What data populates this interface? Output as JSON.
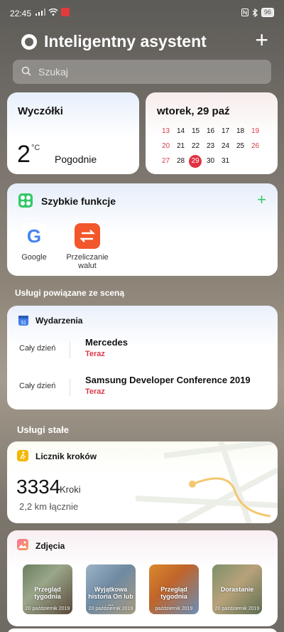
{
  "status": {
    "time": "22:45",
    "battery": "96"
  },
  "header": {
    "title": "Inteligentny asystent"
  },
  "search": {
    "placeholder": "Szukaj"
  },
  "weather": {
    "city": "Wyczółki",
    "temp": "2",
    "unit": "°C",
    "condition": "Pogodnie"
  },
  "calendar": {
    "date": "wtorek, 29 paź",
    "days": [
      {
        "d": "13",
        "red": true
      },
      {
        "d": "14"
      },
      {
        "d": "15"
      },
      {
        "d": "16"
      },
      {
        "d": "17"
      },
      {
        "d": "18"
      },
      {
        "d": "19",
        "red": true
      },
      {
        "d": "20",
        "red": true
      },
      {
        "d": "21"
      },
      {
        "d": "22"
      },
      {
        "d": "23"
      },
      {
        "d": "24"
      },
      {
        "d": "25"
      },
      {
        "d": "26",
        "red": true
      },
      {
        "d": "27",
        "red": true
      },
      {
        "d": "28"
      },
      {
        "d": "29",
        "today": true
      },
      {
        "d": "30"
      },
      {
        "d": "31"
      }
    ]
  },
  "quick": {
    "title": "Szybkie funkcje",
    "apps": [
      "Google",
      "Przeliczanie walut"
    ]
  },
  "sections": {
    "scene": "Usługi powiązane ze sceną",
    "fixed": "Usługi stałe"
  },
  "events": {
    "title": "Wydarzenia",
    "icon_label": "31",
    "items": [
      {
        "when": "Cały dzień",
        "name": "Mercedes",
        "status": "Teraz"
      },
      {
        "when": "Cały dzień",
        "name": "Samsung Developer Conference 2019",
        "status": "Teraz"
      }
    ]
  },
  "steps": {
    "title": "Licznik kroków",
    "count": "3334",
    "unit": "Kroki",
    "total": "2,2 km łącznie"
  },
  "photos": {
    "title": "Zdjęcia",
    "items": [
      {
        "caption": "Przegląd tygodnia",
        "date": "20 październik 2019"
      },
      {
        "caption": "Wyjątkowa historia On lub ...",
        "date": "20 październik 2019"
      },
      {
        "caption": "Przegląd tygodnia",
        "date": "październik 2019"
      },
      {
        "caption": "Dorastanie",
        "date": "20 październik 2019"
      }
    ]
  },
  "colors": {
    "accent_green": "#35c86a",
    "accent_red": "#d93b4b"
  }
}
